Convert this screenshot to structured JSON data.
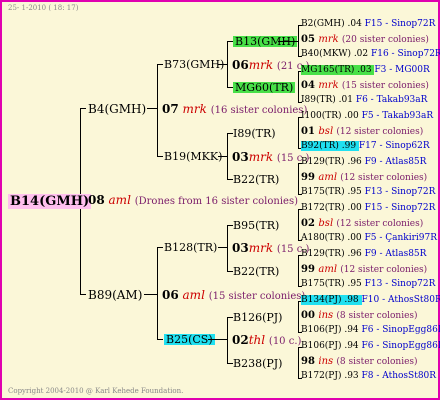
{
  "header": {
    "date": "25-  1-2010  ( 18: 17)"
  },
  "footer": {
    "copyright": "Copyright 2004-2010 @ Karl Kehede Foundation."
  },
  "root": {
    "name": "B14(GMH)"
  },
  "g1": {
    "mother_num": "08",
    "mother_mark": "aml",
    "mother_note": "(Drones from 16 sister colonies)",
    "upper": {
      "name": "B4(GMH)",
      "num": "07",
      "mark": "mrk",
      "note": "(16 sister colonies)"
    },
    "lower": {
      "name": "B89(AM)",
      "num": "06",
      "mark": "aml",
      "note": "(15 sister colonies)"
    }
  },
  "g2": {
    "b73": {
      "name": "B73(GMH)",
      "num": "06",
      "mark": "mrk",
      "note": "(21 c.)"
    },
    "b19": {
      "name": "B19(MKK)",
      "num": "03",
      "mark": "mrk",
      "note": "(15 c.)"
    },
    "b128": {
      "name": "B128(TR)",
      "num": "03",
      "mark": "mrk",
      "note": "(15 c.)"
    },
    "b25": {
      "name": "B25(CS)",
      "num": "02",
      "mark": "thl",
      "note": "(10 c.)"
    }
  },
  "g3": {
    "b13": {
      "name": "B13(GMH)"
    },
    "mg60": {
      "name": "MG60(TR)"
    },
    "i89": {
      "name": "I89(TR)"
    },
    "b22a": {
      "name": "B22(TR)"
    },
    "b95": {
      "name": "B95(TR)"
    },
    "b22b": {
      "name": "B22(TR)"
    },
    "b126": {
      "name": "B126(PJ)"
    },
    "b238": {
      "name": "B238(PJ)"
    }
  },
  "g4": [
    {
      "text": "B2(GMH) .04",
      "code": "F15 - Sinop72R"
    },
    {
      "num": "05",
      "mark": "mrk",
      "note": "(20 sister colonies)"
    },
    {
      "text": "B40(MKW) .02",
      "code": "F16 - Sinop72R"
    },
    {
      "text": "MG165(TR) .03",
      "code": "F3 - MG00R"
    },
    {
      "num": "04",
      "mark": "mrk",
      "note": "(15 sister colonies)"
    },
    {
      "text": "I89(TR) .01",
      "code": "F6 - Takab93aR"
    },
    {
      "text": "I100(TR) .00",
      "code": "F5 - Takab93aR"
    },
    {
      "num": "01",
      "mark": "bsl",
      "note": "(12 sister colonies)"
    },
    {
      "text": "B92(TR) .99",
      "code": "F17 - Sinop62R"
    },
    {
      "text": "B129(TR) .96",
      "code": "F9 - Atlas85R"
    },
    {
      "num": "99",
      "mark": "aml",
      "note": "(12 sister colonies)"
    },
    {
      "text": "B175(TR) .95",
      "code": "F13 - Sinop72R"
    },
    {
      "text": "B172(TR) .00",
      "code": "F15 - Sinop72R"
    },
    {
      "num": "02",
      "mark": "bsl",
      "note": "(12 sister colonies)"
    },
    {
      "text": "A180(TR) .00",
      "code": "F5 - Çankiri97R"
    },
    {
      "text": "B129(TR) .96",
      "code": "F9 - Atlas85R"
    },
    {
      "num": "99",
      "mark": "aml",
      "note": "(12 sister colonies)"
    },
    {
      "text": "B175(TR) .95",
      "code": "F13 - Sinop72R"
    },
    {
      "text": "B134(PJ) .98",
      "code": "F10 - AthosSt80R"
    },
    {
      "num": "00",
      "mark": "ins",
      "note": "(8 sister colonies)"
    },
    {
      "text": "B106(PJ) .94",
      "code": "F6 - SinopEgg86R"
    },
    {
      "text": "B106(PJ) .94",
      "code": "F6 - SinopEgg86R"
    },
    {
      "num": "98",
      "mark": "ins",
      "note": "(8 sister colonies)"
    },
    {
      "text": "B172(PJ) .93",
      "code": "F8 - AthosSt80R"
    }
  ]
}
